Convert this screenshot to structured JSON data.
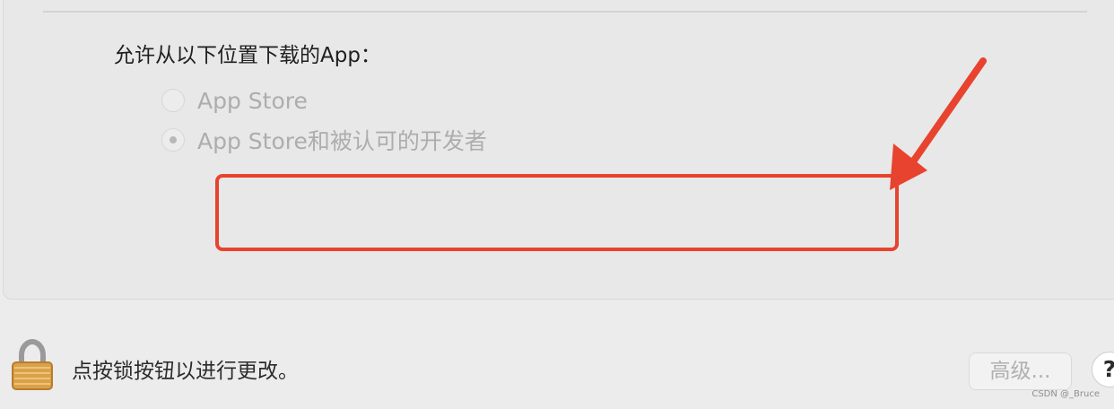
{
  "security": {
    "section_title": "允许从以下位置下载的App：",
    "options": [
      {
        "label": "App Store",
        "selected": false
      },
      {
        "label": "App Store和被认可的开发者",
        "selected": true
      }
    ]
  },
  "footer": {
    "lock_message": "点按锁按钮以进行更改。",
    "advanced_button": "高级...",
    "help_button": "?"
  },
  "annotation": {
    "color": "#e8432e"
  },
  "icons": {
    "lock": "padlock-icon",
    "arrow": "red-arrow-annotation"
  },
  "watermark": "CSDN @_Bruce"
}
